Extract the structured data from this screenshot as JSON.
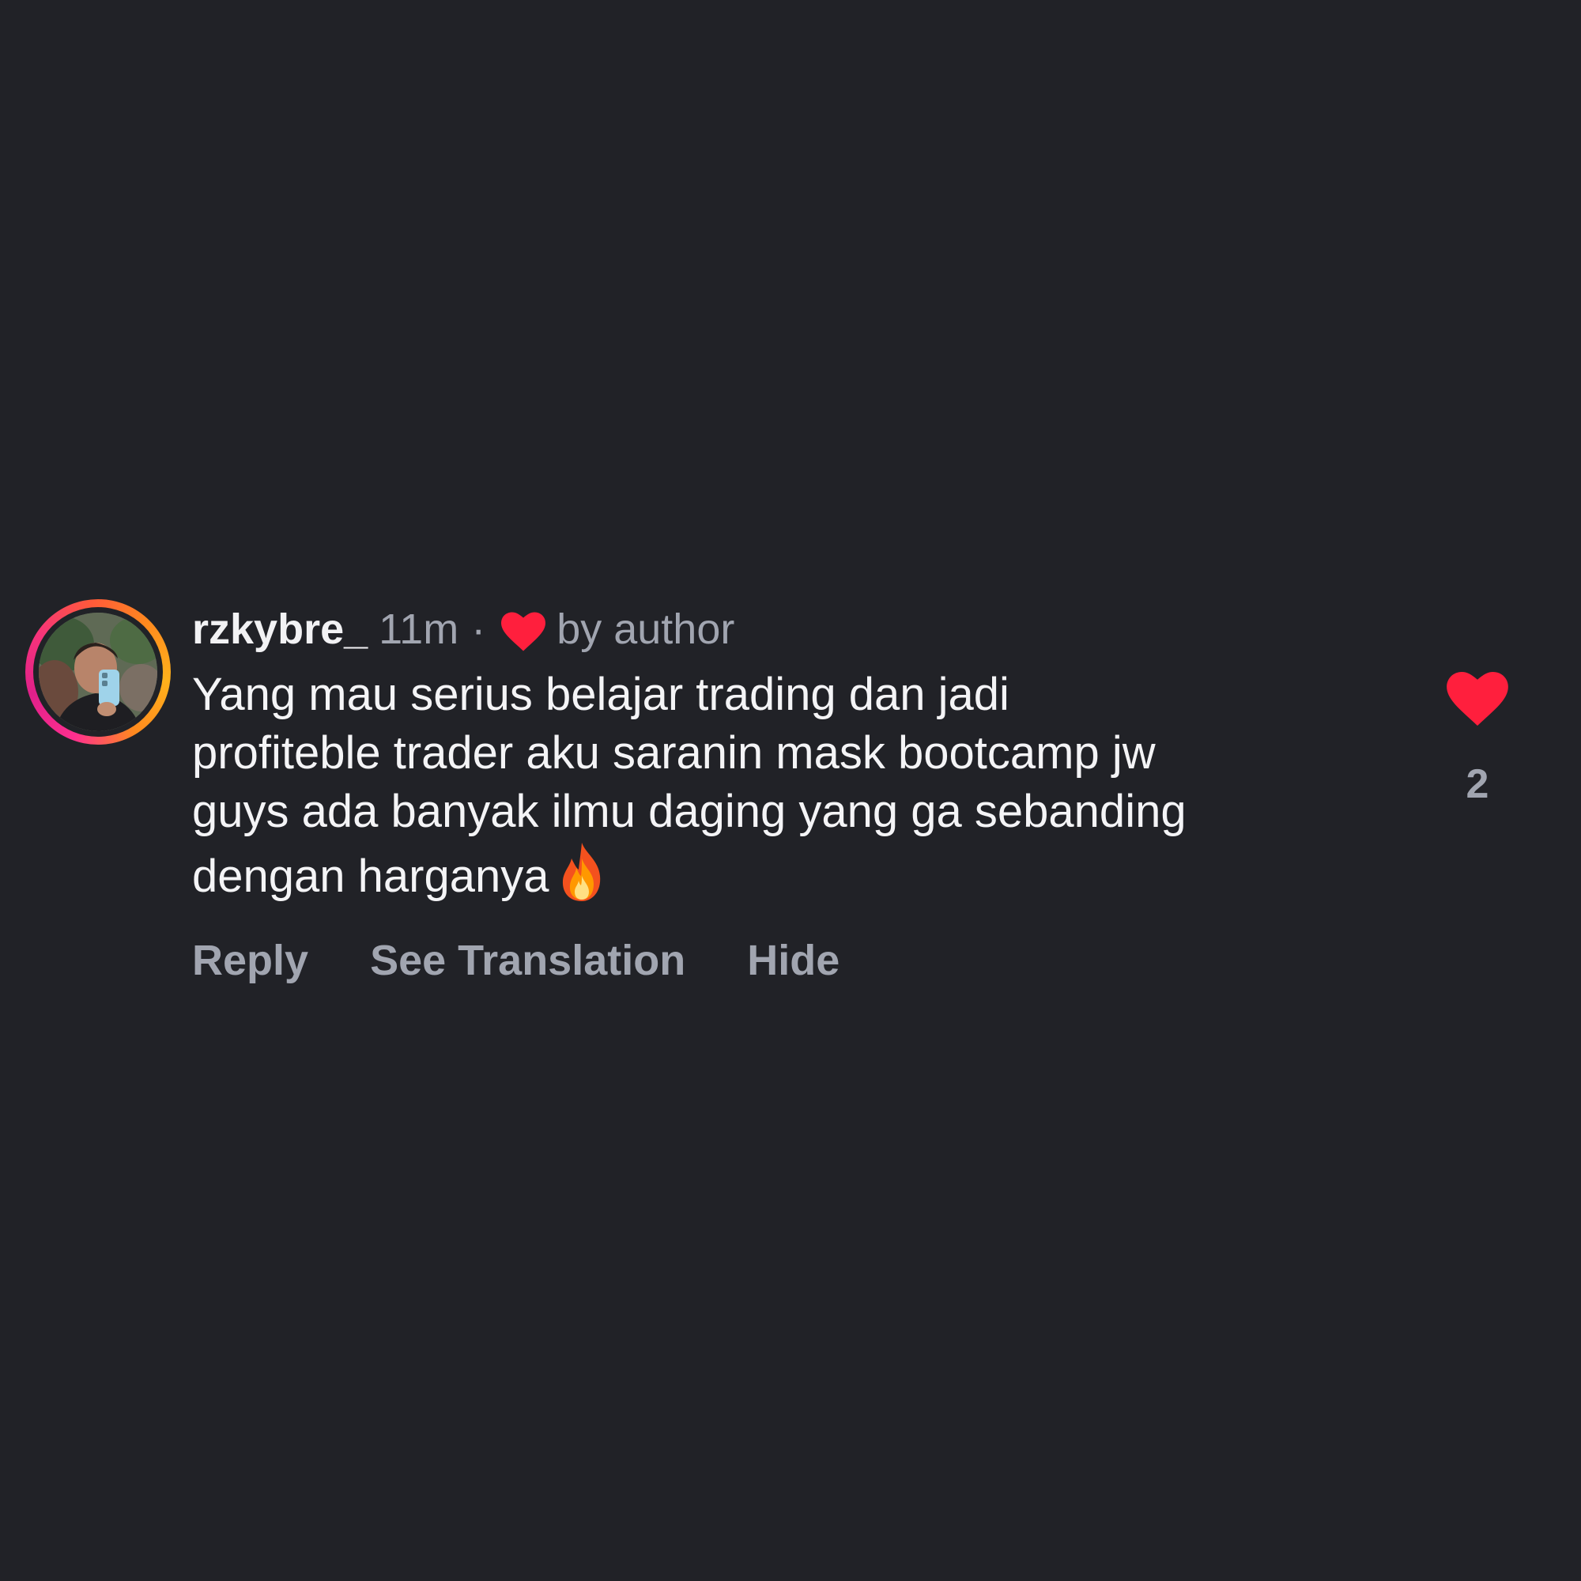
{
  "comment": {
    "username": "rzkybre_",
    "time": "11m",
    "separator": "·",
    "liked_by_author_label": "by author",
    "text_lines": [
      "Yang mau serius belajar trading dan jadi",
      "profiteble trader aku saranin mask bootcamp jw",
      "guys ada banyak ilmu daging yang ga sebanding",
      "dengan harganya"
    ],
    "emoji": "fire-emoji",
    "like_count": "2",
    "actions": {
      "reply": "Reply",
      "see_translation": "See Translation",
      "hide": "Hide"
    }
  },
  "colors": {
    "background": "#212227",
    "primary_text": "#f4f4f6",
    "secondary_text": "#a1a5b0",
    "heart": "#ff1f3d"
  },
  "icons": {
    "liked_by_author": "heart-icon",
    "like_button": "heart-icon",
    "avatar": "avatar-photo"
  }
}
